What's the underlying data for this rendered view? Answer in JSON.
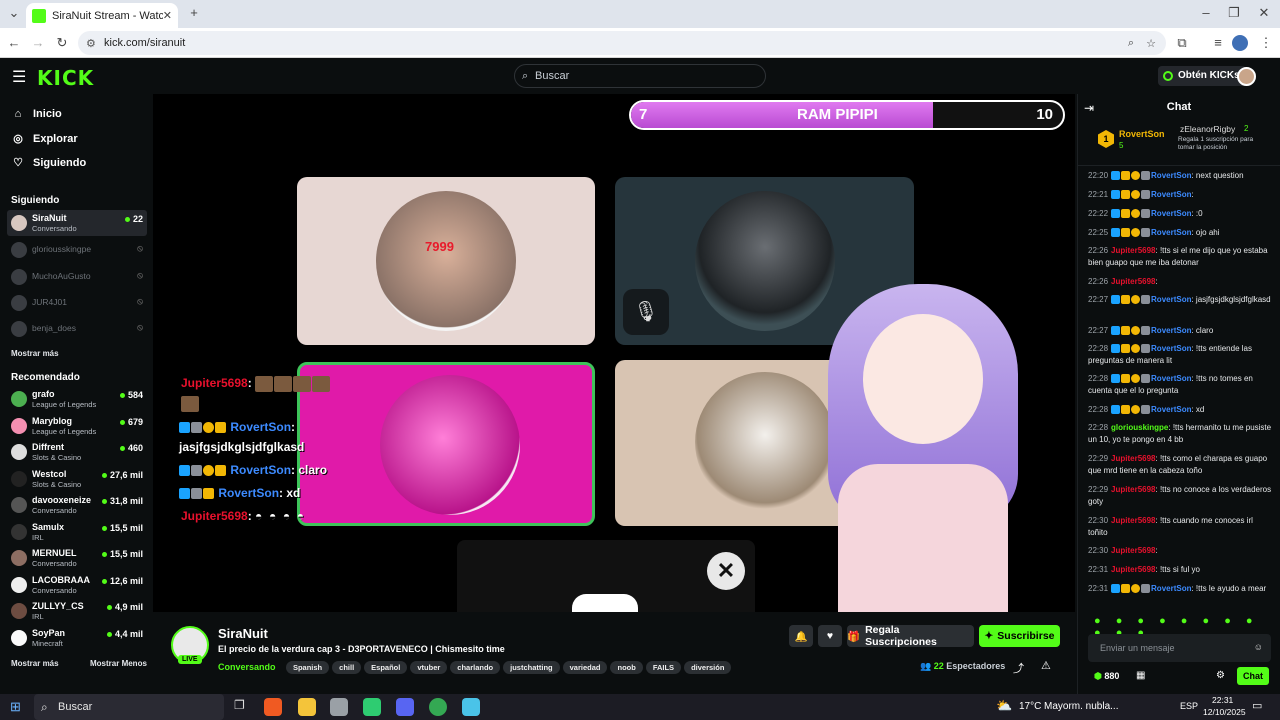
{
  "browser": {
    "tab_title": "SiraNuit Stream - Watch Live o",
    "url": "kick.com/siranuit"
  },
  "topnav": {
    "logo": "KICK",
    "search_placeholder": "Buscar",
    "kicks_label": "Obtén KICKs"
  },
  "sidebar": {
    "nav": [
      {
        "label": "Inicio",
        "icon": "home-icon"
      },
      {
        "label": "Explorar",
        "icon": "compass-icon"
      },
      {
        "label": "Siguiendo",
        "icon": "heart-icon"
      }
    ],
    "following_title": "Siguiendo",
    "following": [
      {
        "name": "SiraNuit",
        "sub": "Conversando",
        "count": "22",
        "live": true
      },
      {
        "name": "gloriousskingpe",
        "live": false
      },
      {
        "name": "MuchoAuGusto",
        "live": false
      },
      {
        "name": "JUR4J01",
        "live": false
      },
      {
        "name": "benja_does",
        "live": false
      }
    ],
    "show_more": "Mostrar más",
    "recommended_title": "Recomendado",
    "recommended": [
      {
        "name": "grafo",
        "sub": "League of Legends",
        "count": "584"
      },
      {
        "name": "Maryblog",
        "sub": "League of Legends",
        "count": "679"
      },
      {
        "name": "Diffrent",
        "sub": "Slots & Casino",
        "count": "460"
      },
      {
        "name": "Westcol",
        "sub": "Slots & Casino",
        "count": "27,6 mil"
      },
      {
        "name": "davooxeneize",
        "sub": "Conversando",
        "count": "31,8 mil"
      },
      {
        "name": "Samulx",
        "sub": "IRL",
        "count": "15,5 mil"
      },
      {
        "name": "MERNUEL",
        "sub": "Conversando",
        "count": "15,5 mil"
      },
      {
        "name": "LACOBRAAA",
        "sub": "Conversando",
        "count": "12,6 mil"
      },
      {
        "name": "ZULLYY_CS",
        "sub": "IRL",
        "count": "4,9 mil"
      },
      {
        "name": "SoyPan",
        "sub": "Minecraft",
        "count": "4,4 mil"
      }
    ],
    "show_more2": "Mostrar más",
    "show_less": "Mostrar Menos"
  },
  "player": {
    "ram_left": "7",
    "ram_title": "RAM PIPIPI",
    "ram_right": "10",
    "ram_progress": 0.7,
    "overlay_chat": [
      {
        "user": "Jupiter5698",
        "text": ":"
      },
      {
        "user": "RovertSon",
        "text": ":"
      },
      {
        "user": "",
        "text": "jasjfgsjdkglsjdfglkasd"
      },
      {
        "user": "RovertSon",
        "text": ": claro"
      },
      {
        "user": "RovertSon",
        "text": ": xd"
      },
      {
        "user": "Jupiter5698",
        "text": ":"
      }
    ],
    "cam_label": "7999"
  },
  "stream": {
    "streamer": "SiraNuit",
    "live": "LIVE",
    "title": "El precio de la verdura cap 3 - D3PORTAVENECO | Chismesito time",
    "category": "Conversando",
    "tags": [
      "Spanish",
      "chill",
      "Español",
      "vtuber",
      "charlando",
      "justchatting",
      "variedad",
      "noob",
      "FAILS",
      "diversión"
    ],
    "gift_label": "Regala Suscripciones",
    "subscribe_label": "Suscribirse",
    "viewers": "22",
    "viewers_label": "Espectadores"
  },
  "chat": {
    "title": "Chat",
    "pinned": {
      "rank": "1",
      "user": "RovertSon",
      "count": "5",
      "user2": "zEleanorRigby",
      "count2": "2",
      "note": "Regala 1 suscripción para tomar la posición"
    },
    "messages": [
      {
        "time": "22:20",
        "user": "RovertSon",
        "color": "blue",
        "badges": true,
        "text": ": next question"
      },
      {
        "time": "22:21",
        "user": "RovertSon",
        "color": "blue",
        "badges": true,
        "text": ":"
      },
      {
        "time": "22:22",
        "user": "RovertSon",
        "color": "blue",
        "badges": true,
        "text": ": :0"
      },
      {
        "time": "22:25",
        "user": "RovertSon",
        "color": "blue",
        "badges": true,
        "text": ": ojo ahi"
      },
      {
        "time": "22:26",
        "user": "Jupiter5698",
        "color": "red",
        "badges": false,
        "text": ": !tts si el me dijo que yo estaba bien guapo que me iba detonar"
      },
      {
        "time": "22:26",
        "user": "Jupiter5698",
        "color": "red",
        "badges": false,
        "text": ":"
      },
      {
        "time": "22:27",
        "user": "RovertSon",
        "color": "blue",
        "badges": true,
        "text": ": jasjfgsjdkglsjdfglkasd"
      },
      {
        "time": "22:27",
        "user": "RovertSon",
        "color": "blue",
        "badges": true,
        "text": ": claro"
      },
      {
        "time": "22:28",
        "user": "RovertSon",
        "color": "blue",
        "badges": true,
        "text": ": !tts entiende las preguntas de manera lit"
      },
      {
        "time": "22:28",
        "user": "RovertSon",
        "color": "blue",
        "badges": true,
        "text": ": !tts no tomes en cuenta que el lo pregunta"
      },
      {
        "time": "22:28",
        "user": "RovertSon",
        "color": "blue",
        "badges": true,
        "text": ": xd"
      },
      {
        "time": "22:28",
        "user": "gloriouskingpe",
        "color": "green",
        "badges": false,
        "text": ": !tts hermanito tu me pusiste un 10, yo te pongo en 4 bb"
      },
      {
        "time": "22:29",
        "user": "Jupiter5698",
        "color": "red",
        "badges": false,
        "text": ": !tts como el charapa es guapo que mrd tiene en la cabeza toño"
      },
      {
        "time": "22:29",
        "user": "Jupiter5698",
        "color": "red",
        "badges": false,
        "text": ": !tts no conoce a los verdaderos goty"
      },
      {
        "time": "22:30",
        "user": "Jupiter5698",
        "color": "red",
        "badges": false,
        "text": ": !tts cuando me conoces irl toñito"
      },
      {
        "time": "22:30",
        "user": "Jupiter5698",
        "color": "red",
        "badges": false,
        "text": ":"
      },
      {
        "time": "22:31",
        "user": "Jupiter5698",
        "color": "red",
        "badges": false,
        "text": ": !tts si ful yo"
      },
      {
        "time": "22:31",
        "user": "RovertSon",
        "color": "blue",
        "badges": true,
        "text": ": !tts le ayudo a mear"
      }
    ],
    "input_placeholder": "Enviar un mensaje",
    "points": "880",
    "send_label": "Chat"
  },
  "taskbar": {
    "search": "Buscar",
    "weather": "17°C",
    "weather_text": "Mayorm. nubla...",
    "lang": "ESP",
    "time": "22:31",
    "date": "12/10/2025"
  }
}
